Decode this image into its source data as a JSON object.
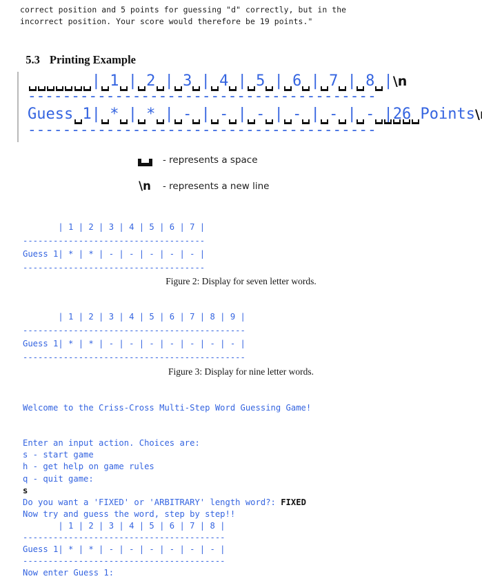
{
  "document": {
    "intro_paragraph": "correct position and 5 points for guessing \"d\" correctly, but in the\nincorrect position. Your score would therefore be 19 points.\"",
    "section": {
      "number": "5.3",
      "title": "Printing Example"
    }
  },
  "colors": {
    "terminal_blue": "#3464e0",
    "ink_black": "#111111",
    "rule_gray": "#b9b9b9"
  },
  "big_figure": {
    "header_row": "       | 1 | 2 | 3 | 4 | 5 | 6 | 7 | 8 |",
    "header_newline": "\\n",
    "rule_top": "----------------------------------------",
    "guess_row": "Guess 1| * | * | - | - | - | - | - | - |",
    "points_label": "26 Points",
    "guess_newline": "\\n",
    "rule_bottom": "----------------------------------------",
    "space_marker_name": "space-marker"
  },
  "legend": {
    "space": {
      "glyph": "space-glyph",
      "text": "- represents a space"
    },
    "newline": {
      "glyph": "\\n",
      "text": "- represents a new line"
    }
  },
  "figure2": {
    "lines": [
      "       | 1 | 2 | 3 | 4 | 5 | 6 | 7 |",
      "------------------------------------",
      "Guess 1| * | * | - | - | - | - | - |",
      "------------------------------------"
    ],
    "caption": "Figure 2: Display for seven letter words."
  },
  "figure3": {
    "lines": [
      "       | 1 | 2 | 3 | 4 | 5 | 6 | 7 | 8 | 9 |",
      "--------------------------------------------",
      "Guess 1| * | * | - | - | - | - | - | - | - |",
      "--------------------------------------------"
    ],
    "caption": "Figure 3: Display for nine letter words."
  },
  "terminal": {
    "welcome": "Welcome to the Criss-Cross Multi-Step Word Guessing Game!",
    "prompt_action": "Enter an input action. Choices are:",
    "choice_start": "s - start game",
    "choice_help": "h - get help on game rules",
    "choice_quit": "q - quit game:",
    "user_action": "s",
    "prompt_length": "Do you want a 'FIXED' or 'ARBITRARY' length word?: ",
    "user_length": "FIXED",
    "prompt_guess_intro": "Now try and guess the word, step by step!!",
    "board_header": "       | 1 | 2 | 3 | 4 | 5 | 6 | 7 | 8 |",
    "board_rule_top": "----------------------------------------",
    "board_guess": "Guess 1| * | * | - | - | - | - | - | - |",
    "board_rule_bottom": "----------------------------------------",
    "prompt_enter_guess": "Now enter Guess 1:"
  }
}
